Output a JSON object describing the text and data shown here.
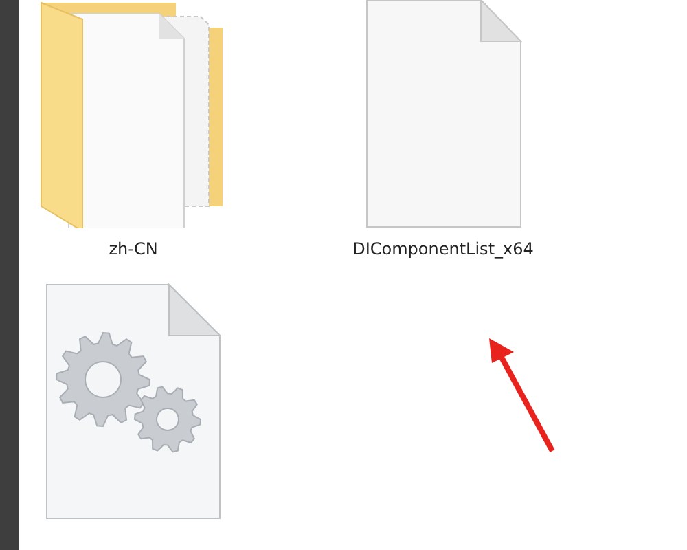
{
  "items": [
    {
      "kind": "folder",
      "label": "zh-CN"
    },
    {
      "kind": "file",
      "label": "DIComponentList_x64"
    },
    {
      "kind": "settings-file"
    }
  ]
}
